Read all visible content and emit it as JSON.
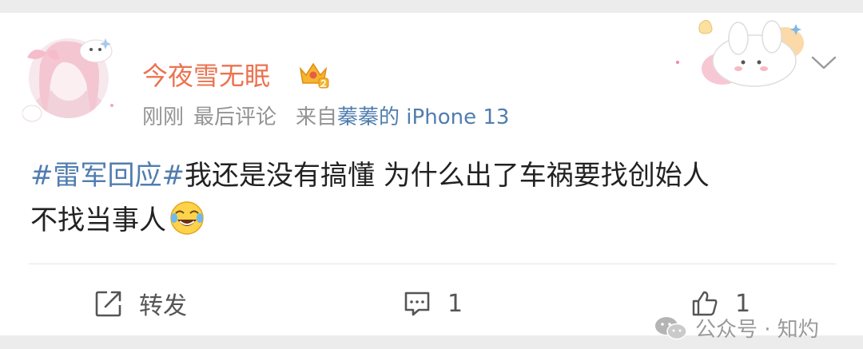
{
  "post": {
    "author": "今夜雪无眠",
    "time": "刚刚",
    "status": "最后评论",
    "source_prefix": "来自",
    "source_device": "蓁蓁的 iPhone 13",
    "topic": "#雷军回应#",
    "text_line1": "我还是没有搞懂 为什么出了车祸要找创始人",
    "text_line2": "不找当事人"
  },
  "actions": {
    "repost_label": "转发",
    "comment_count": "1",
    "like_count": "1"
  },
  "watermark": "公众号 · 知灼",
  "colors": {
    "author_name": "#eb7350",
    "link_blue": "#507daf",
    "meta_gray": "#939393"
  },
  "icons": [
    "avatar-image",
    "crown-badge-icon",
    "decorative-sticker",
    "chevron-down-icon",
    "laugh-cry-emoji",
    "share-icon",
    "comment-icon",
    "like-icon",
    "wechat-icon"
  ]
}
